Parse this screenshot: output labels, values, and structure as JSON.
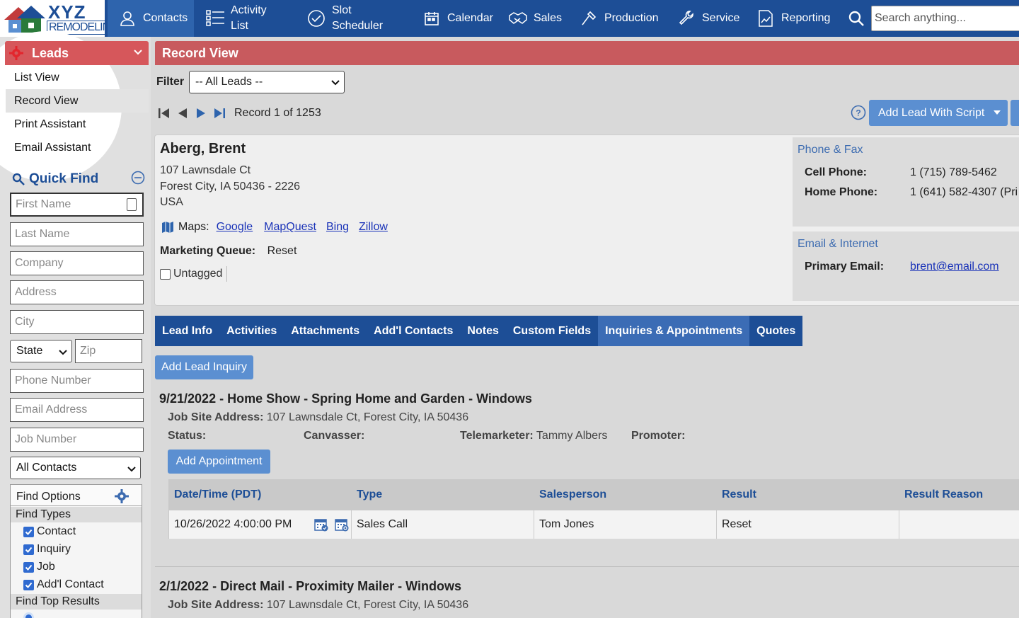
{
  "brand": {
    "name": "XYZ",
    "tagline": "REMODELING"
  },
  "nav": {
    "contacts": "Contacts",
    "activity_list": [
      "Activity",
      "List"
    ],
    "slot_scheduler": [
      "Slot",
      "Scheduler"
    ],
    "calendar": "Calendar",
    "sales": "Sales",
    "production": "Production",
    "service": "Service",
    "reporting": "Reporting",
    "search_placeholder": "Search anything..."
  },
  "leads_menu": {
    "title": "Leads",
    "items": [
      "List View",
      "Record View",
      "Print Assistant",
      "Email Assistant"
    ],
    "selected": "Record View"
  },
  "quick_find": {
    "title": "Quick Find",
    "placeholders": {
      "first_name": "First Name",
      "last_name": "Last Name",
      "company": "Company",
      "address": "Address",
      "city": "City",
      "zip": "Zip",
      "phone": "Phone Number",
      "email": "Email Address",
      "job_number": "Job Number"
    },
    "state_select": "State",
    "contacts_select": "All Contacts",
    "find_options": {
      "title": "Find Options",
      "find_types_label": "Find Types",
      "types": [
        "Contact",
        "Inquiry",
        "Job",
        "Add'l Contact"
      ],
      "find_top_label": "Find Top Results"
    }
  },
  "record_view": {
    "title": "Record View",
    "filter_label": "Filter",
    "filter_value": "-- All Leads --",
    "record_text": "Record 1 of 1253",
    "add_lead_script": "Add Lead With Script"
  },
  "lead": {
    "name": "Aberg, Brent",
    "address_line1": "107 Lawnsdale Ct",
    "address_line2": "Forest City, IA 50436 - 2226",
    "country": "USA",
    "maps_label": "Maps:",
    "map_links": [
      "Google",
      "MapQuest",
      "Bing",
      "Zillow"
    ],
    "marketing_queue_label": "Marketing Queue:",
    "marketing_queue_value": "Reset",
    "untagged_label": "Untagged"
  },
  "phone_fax": {
    "title": "Phone & Fax",
    "cell_label": "Cell Phone:",
    "cell_value": "1 (715) 789-5462",
    "home_label": "Home Phone:",
    "home_value": "1 (641) 582-4307 (Pri"
  },
  "email_internet": {
    "title": "Email & Internet",
    "primary_label": "Primary Email:",
    "primary_value": "brent@email.com"
  },
  "tabs": [
    "Lead Info",
    "Activities",
    "Attachments",
    "Add'l Contacts",
    "Notes",
    "Custom Fields",
    "Inquiries & Appointments",
    "Quotes"
  ],
  "active_tab": "Inquiries & Appointments",
  "add_lead_inquiry": "Add Lead Inquiry",
  "inquiries": [
    {
      "title": "9/21/2022 - Home Show - Spring Home and Garden - Windows",
      "job_site_label": "Job Site Address:",
      "job_site_value": "107 Lawnsdale Ct, Forest City, IA 50436",
      "status_label": "Status:",
      "canvasser_label": "Canvasser:",
      "telemarketer_label": "Telemarketer:",
      "telemarketer_value": "Tammy Albers",
      "promoter_label": "Promoter:",
      "add_appointment": "Add Appointment",
      "columns": [
        "Date/Time (PDT)",
        "Type",
        "Salesperson",
        "Result",
        "Result Reason"
      ],
      "rows": [
        {
          "datetime": "10/26/2022 4:00:00 PM",
          "type": "Sales Call",
          "salesperson": "Tom Jones",
          "result": "Reset",
          "reason": ""
        }
      ]
    },
    {
      "title": "2/1/2022 - Direct Mail - Proximity Mailer - Windows",
      "job_site_label": "Job Site Address:",
      "job_site_value": "107 Lawnsdale Ct, Forest City, IA 50436"
    }
  ],
  "colors": {
    "nav_blue": "#1d4e96",
    "leads_red": "#d6575b",
    "button_blue": "#5b8fd1",
    "link_blue": "#1a33b8"
  }
}
